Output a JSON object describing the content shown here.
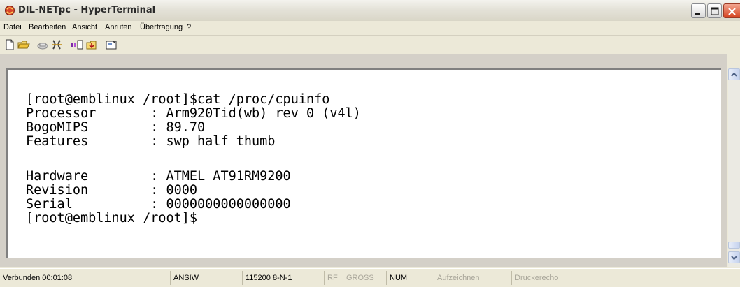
{
  "window": {
    "title": "DIL-NETpc - HyperTerminal"
  },
  "menu": [
    "Datei",
    "Bearbeiten",
    "Ansicht",
    "Anrufen",
    "Übertragung",
    "?"
  ],
  "toolbar": {
    "icons": [
      "new-icon",
      "open-icon",
      "phone-icon",
      "disconnect-icon",
      "send-icon",
      "receive-icon",
      "properties-icon"
    ]
  },
  "terminal": {
    "lines": [
      "[root@emblinux /root]$cat /proc/cpuinfo",
      "Processor       : Arm920Tid(wb) rev 0 (v4l)",
      "BogoMIPS        : 89.70",
      "Features        : swp half thumb",
      "",
      "Hardware        : ATMEL AT91RM9200",
      "Revision        : 0000",
      "Serial          : 0000000000000000",
      "[root@emblinux /root]$"
    ]
  },
  "status": {
    "connected": "Verbunden 00:01:08",
    "emulation": "ANSIW",
    "port_settings": "115200 8-N-1",
    "rf": "RF",
    "gross": "GROSS",
    "num": "NUM",
    "capture": "Aufzeichnen",
    "print_echo": "Druckerecho"
  }
}
